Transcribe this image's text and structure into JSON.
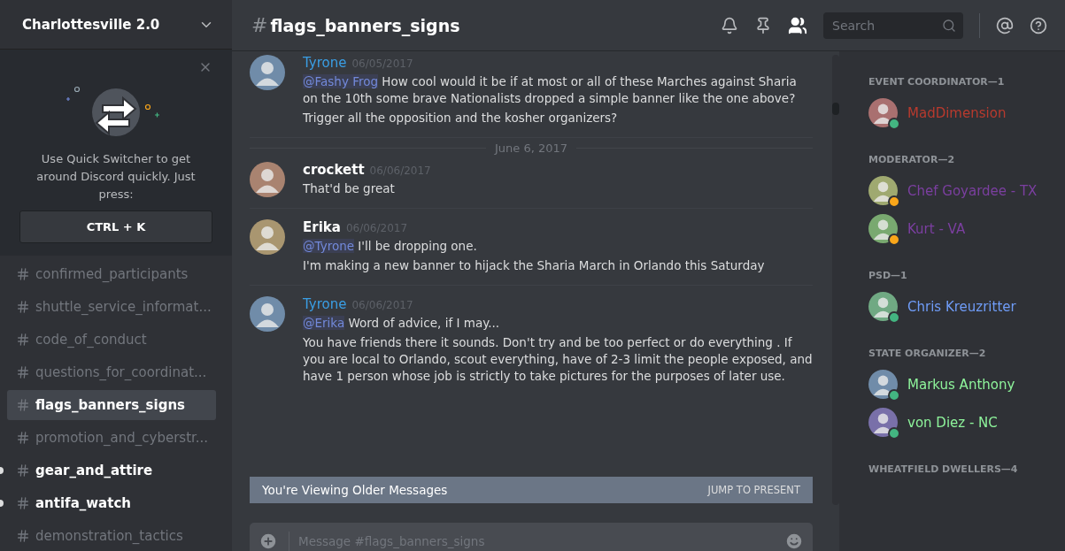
{
  "server": {
    "name": "Charlottesville 2.0"
  },
  "quick_switcher": {
    "text": "Use Quick Switcher to get around Discord quickly. Just press:",
    "shortcut": "CTRL + K"
  },
  "channels": [
    {
      "name": "confirmed_participants",
      "selected": false,
      "unread": false
    },
    {
      "name": "shuttle_service_informat...",
      "selected": false,
      "unread": false
    },
    {
      "name": "code_of_conduct",
      "selected": false,
      "unread": false
    },
    {
      "name": "questions_for_coordinat...",
      "selected": false,
      "unread": false
    },
    {
      "name": "flags_banners_signs",
      "selected": true,
      "unread": false
    },
    {
      "name": "promotion_and_cyberstr...",
      "selected": false,
      "unread": false
    },
    {
      "name": "gear_and_attire",
      "selected": false,
      "unread": true
    },
    {
      "name": "antifa_watch",
      "selected": false,
      "unread": true
    },
    {
      "name": "demonstration_tactics",
      "selected": false,
      "unread": false
    }
  ],
  "header": {
    "hash": "#",
    "channel": "flags_banners_signs",
    "search_placeholder": "Search"
  },
  "messages": [
    {
      "kind": "message",
      "author": "Tyrone",
      "color": "#3a9ee4",
      "date": "06/05/2017",
      "paragraphs": [
        {
          "mention": "@Fashy Frog",
          "text": "How cool would it be if at most or all of these Marches against Sharia on the 10th some brave Nationalists dropped a simple banner like the one above?"
        },
        {
          "text": "Trigger all the opposition and the kosher organizers?"
        }
      ]
    },
    {
      "kind": "divider",
      "label": "June 6, 2017"
    },
    {
      "kind": "message",
      "author": "crockett",
      "color": "#ffffff",
      "date": "06/06/2017",
      "paragraphs": [
        {
          "text": "That'd be great"
        }
      ]
    },
    {
      "kind": "message",
      "author": "Erika",
      "color": "#ffffff",
      "date": "06/06/2017",
      "paragraphs": [
        {
          "mention": "@Tyrone",
          "text": "I'll be dropping one."
        },
        {
          "text": "I'm making a new banner to hijack the Sharia March in Orlando this Saturday"
        }
      ]
    },
    {
      "kind": "message",
      "author": "Tyrone",
      "color": "#3a9ee4",
      "date": "06/06/2017",
      "paragraphs": [
        {
          "mention": "@Erika",
          "text": "Word of advice, if I may..."
        },
        {
          "text": "You have friends there it sounds. Don't try and be too perfect or do everything . If you are local to Orlando, scout everything, have of 2-3 limit the people exposed, and have 1 person whose job is strictly to take pictures for the purposes of later use."
        }
      ]
    }
  ],
  "older_bar": {
    "text": "You're Viewing Older Messages",
    "action": "JUMP TO PRESENT"
  },
  "composer": {
    "placeholder": "Message #flags_banners_signs"
  },
  "member_groups": [
    {
      "title": "EVENT COORDINATOR—1",
      "members": [
        {
          "name": "MadDimension",
          "color": "#b83a2e",
          "status": {
            "color": "#43b581"
          }
        }
      ]
    },
    {
      "title": "MODERATOR—2",
      "members": [
        {
          "name": "Chef Goyardee - TX",
          "color": "#7b3fa0",
          "status": {
            "color": "#faa61a"
          }
        },
        {
          "name": "Kurt - VA",
          "color": "#7b3fa0",
          "status": {
            "color": "#faa61a"
          }
        }
      ]
    },
    {
      "title": "PSD—1",
      "members": [
        {
          "name": "Chris Kreuzritter",
          "color": "#6f9cf7",
          "status": {
            "color": "#43b581"
          }
        }
      ]
    },
    {
      "title": "STATE ORGANIZER—2",
      "members": [
        {
          "name": "Markus Anthony",
          "color": "#8ef49b",
          "status": {
            "color": "#43b581"
          }
        },
        {
          "name": "von Diez - NC",
          "color": "#8ef49b",
          "status": {
            "color": "#43b581"
          }
        }
      ]
    },
    {
      "title": "WHEATFIELD DWELLERS—4"
    }
  ]
}
